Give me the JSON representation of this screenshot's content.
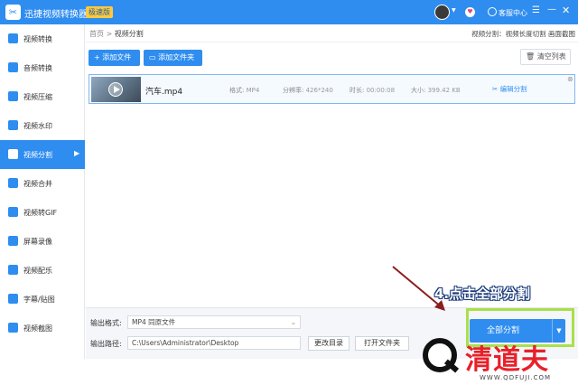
{
  "titlebar": {
    "logo_glyph": "✂",
    "app_title": "迅捷视频转换器",
    "badge": "极速版",
    "service_label": "客服中心",
    "menu_glyph": "☰",
    "min_glyph": "—",
    "close_glyph": "✕"
  },
  "sidebar": {
    "items": [
      {
        "label": "视频转换",
        "icon": "video-convert-icon"
      },
      {
        "label": "音频转换",
        "icon": "audio-convert-icon"
      },
      {
        "label": "视频压缩",
        "icon": "video-compress-icon"
      },
      {
        "label": "视频水印",
        "icon": "video-watermark-icon"
      },
      {
        "label": "视频分割",
        "icon": "video-split-icon",
        "active": true
      },
      {
        "label": "视频合并",
        "icon": "video-merge-icon"
      },
      {
        "label": "视频转GIF",
        "icon": "video-gif-icon"
      },
      {
        "label": "屏幕录像",
        "icon": "screen-record-icon"
      },
      {
        "label": "视频配乐",
        "icon": "video-music-icon"
      },
      {
        "label": "字幕/贴图",
        "icon": "subtitle-icon"
      },
      {
        "label": "视频截图",
        "icon": "video-screenshot-icon"
      }
    ]
  },
  "breadcrumb": {
    "home": "首页",
    "sep": ">",
    "current": "视频分割"
  },
  "right_tools": "视频分割：视频长度切割 画面截图",
  "toolbar": {
    "add_file": "+ 添加文件",
    "add_folder": "添加文件夹",
    "clear_list": "清空列表"
  },
  "file": {
    "name": "汽车.mp4",
    "format_label": "格式:",
    "format_value": "MP4",
    "resolution_label": "分辨率:",
    "resolution_value": "426*240",
    "duration_label": "时长:",
    "duration_value": "00:00:08",
    "size_label": "大小:",
    "size_value": "399.42 KB",
    "edit_split": "编辑分割"
  },
  "bottom": {
    "output_format_label": "输出格式:",
    "output_format_value": "MP4  同原文件",
    "output_path_label": "输出路径:",
    "output_path_value": "C:\\Users\\Administrator\\Desktop",
    "change_dir": "更改目录",
    "open_folder": "打开文件夹",
    "split_all": "全部分割"
  },
  "annotation": "4.点击全部分割",
  "watermark": {
    "text": "清道夫",
    "url": "WWW.QDFUJI.COM"
  },
  "colors": {
    "accent": "#2f8df0",
    "highlight": "#a8e04a",
    "annotation_arrow": "#8b1e1e",
    "watermark_red": "#e8202a"
  }
}
